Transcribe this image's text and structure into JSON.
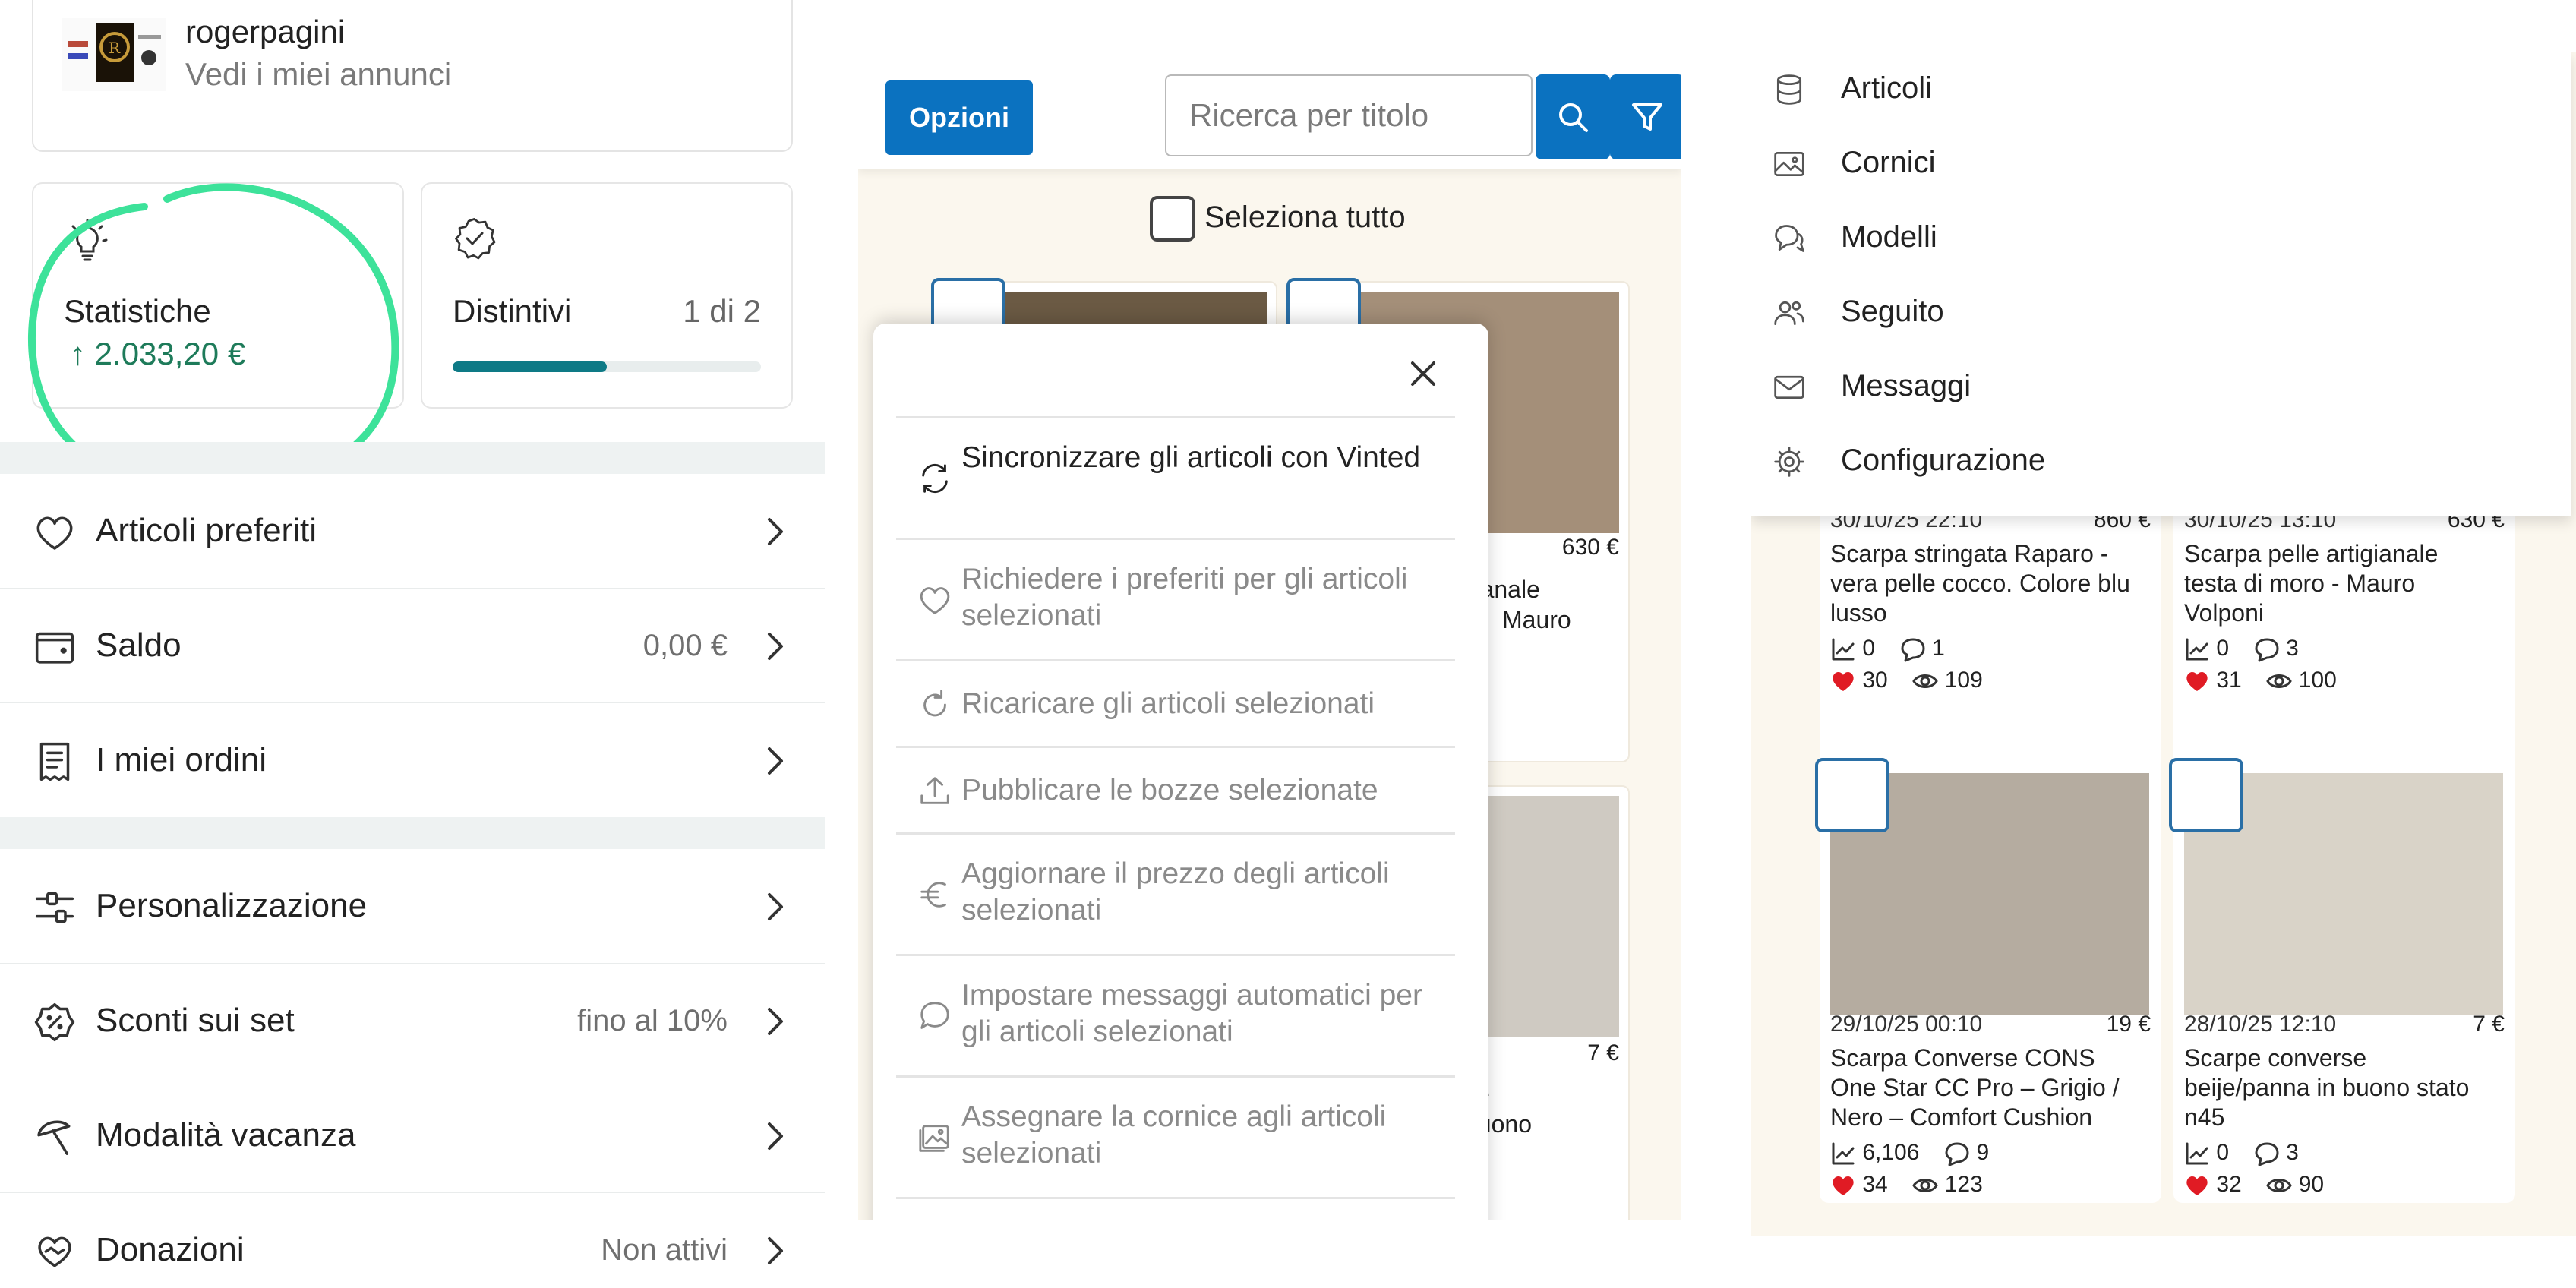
{
  "account": {
    "username": "rogerpagini",
    "subtitle": "Vedi i miei annunci",
    "stats": {
      "label": "Statistiche",
      "value": "↑ 2.033,20 €"
    },
    "badges": {
      "label": "Distintivi",
      "count": "1 di 2",
      "progress": 0.5
    },
    "menu": [
      {
        "icon": "heart-icon",
        "label": "Articoli preferiti",
        "value": ""
      },
      {
        "icon": "wallet-icon",
        "label": "Saldo",
        "value": "0,00 €"
      },
      {
        "icon": "receipt-icon",
        "label": "I miei ordini",
        "value": ""
      },
      {
        "icon": "sliders-icon",
        "label": "Personalizzazione",
        "value": ""
      },
      {
        "icon": "discount-tag-icon",
        "label": "Sconti sui set",
        "value": "fino al 10%"
      },
      {
        "icon": "umbrella-icon",
        "label": "Modalità vacanza",
        "value": ""
      },
      {
        "icon": "donation-heart-icon",
        "label": "Donazioni",
        "value": "Non attivi"
      }
    ],
    "marker_color": "#3de29a",
    "accent_color": "#0e7a86"
  },
  "tool": {
    "options_label": "Opzioni",
    "search_placeholder": "Ricerca per titolo",
    "select_all": "Seleziona tutto",
    "background_cards": {
      "price_1": "630 €",
      "title_1_line1": "rtigianale",
      "title_1_line2": "Mauro",
      "price_2": "7 €",
      "title_2_line1": "se",
      "title_2_line2": "buono"
    },
    "sheet_items": [
      {
        "icon": "sync-icon",
        "label": "Sincronizzare gli articoli con Vinted",
        "enabled": true
      },
      {
        "icon": "heart-icon",
        "label": "Richiedere i preferiti per gli articoli selezionati",
        "enabled": false
      },
      {
        "icon": "reload-icon",
        "label": "Ricaricare gli articoli selezionati",
        "enabled": false
      },
      {
        "icon": "upload-icon",
        "label": "Pubblicare le bozze selezionate",
        "enabled": false
      },
      {
        "icon": "euro-icon",
        "label": "Aggiornare il prezzo degli articoli selezionati",
        "enabled": false
      },
      {
        "icon": "chat-bubble-icon",
        "label": "Impostare messaggi automatici per gli articoli selezionati",
        "enabled": false
      },
      {
        "icon": "image-frame-icon",
        "label": "Assegnare la cornice agli articoli selezionati",
        "enabled": false
      }
    ],
    "primary_color": "#0b72c0"
  },
  "nav_menu": {
    "items": [
      {
        "icon": "database-icon",
        "label": "Articoli"
      },
      {
        "icon": "image-icon",
        "label": "Cornici"
      },
      {
        "icon": "chat-bubbles-icon",
        "label": "Modelli"
      },
      {
        "icon": "users-icon",
        "label": "Seguito"
      },
      {
        "icon": "mail-icon",
        "label": "Messaggi"
      },
      {
        "icon": "gear-icon",
        "label": "Configurazione"
      }
    ]
  },
  "articles": [
    {
      "date": "30/10/25 22:10",
      "price": "860 €",
      "title": "Scarpa stringata Raparo - vera pelle cocco. Colore blu lusso",
      "trend": "0",
      "messages": "1",
      "likes": "30",
      "views": "109"
    },
    {
      "date": "30/10/25 13:10",
      "price": "630 €",
      "title": "Scarpa pelle artigianale testa di moro - Mauro Volponi",
      "trend": "0",
      "messages": "3",
      "likes": "31",
      "views": "100"
    },
    {
      "date": "29/10/25 00:10",
      "price": "19 €",
      "title": "Scarpa Converse CONS One Star CC Pro – Grigio / Nero – Comfort Cushion",
      "trend": "6,106",
      "messages": "9",
      "likes": "34",
      "views": "123"
    },
    {
      "date": "28/10/25 12:10",
      "price": "7 €",
      "title": "Scarpe converse beije/panna in buono stato n45",
      "trend": "0",
      "messages": "3",
      "likes": "32",
      "views": "90"
    }
  ],
  "like_color": "#e01b24"
}
